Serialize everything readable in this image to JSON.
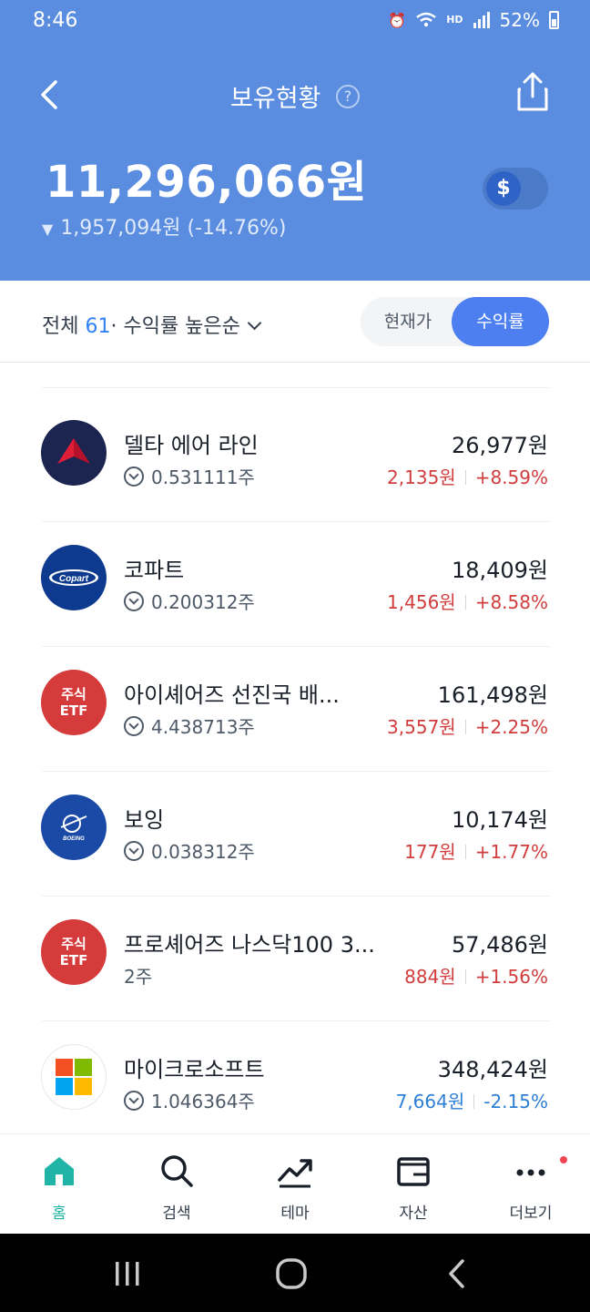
{
  "status_bar": {
    "time": "8:46",
    "hd_label": "HD",
    "battery": "52%"
  },
  "header": {
    "title": "보유현황",
    "help_symbol": "?",
    "total_value": "11,296,066원",
    "change_text": "1,957,094원 (-14.76%)",
    "change_direction": "down",
    "currency_toggle_symbol": "$",
    "background_color": "#5a8de0"
  },
  "filter": {
    "all_label": "전체",
    "count": "61",
    "sort_label": "· 수익률 높은순",
    "segment": {
      "current_price_label": "현재가",
      "return_label": "수익률",
      "selected": "수익률"
    }
  },
  "holdings": [
    {
      "name": "델타 에어 라인",
      "logo": "delta-logo",
      "quantity": "0.531111주",
      "value": "26,977원",
      "profit": "2,135원",
      "return": "+8.59%",
      "direction": "up"
    },
    {
      "name": "코파트",
      "logo": "copart-logo",
      "logo_text": "Copart",
      "quantity": "0.200312주",
      "value": "18,409원",
      "profit": "1,456원",
      "return": "+8.58%",
      "direction": "up"
    },
    {
      "name": "아이셰어즈 선진국 배...",
      "logo": "etf-badge",
      "logo_line1": "주식",
      "logo_line2": "ETF",
      "quantity": "4.438713주",
      "value": "161,498원",
      "profit": "3,557원",
      "return": "+2.25%",
      "direction": "up"
    },
    {
      "name": "보잉",
      "logo": "boeing-logo",
      "logo_text": "BOEING",
      "quantity": "0.038312주",
      "value": "10,174원",
      "profit": "177원",
      "return": "+1.77%",
      "direction": "up"
    },
    {
      "name": "프로셰어즈 나스닥100 3...",
      "logo": "etf-badge",
      "logo_line1": "주식",
      "logo_line2": "ETF",
      "quantity": "2주",
      "value": "57,486원",
      "profit": "884원",
      "return": "+1.56%",
      "direction": "up"
    },
    {
      "name": "마이크로소프트",
      "logo": "microsoft-logo",
      "quantity": "1.046364주",
      "value": "348,424원",
      "profit": "7,664원",
      "return": "-2.15%",
      "direction": "down"
    }
  ],
  "bottom_nav": [
    {
      "label": "홈",
      "icon": "home-icon",
      "active": true
    },
    {
      "label": "검색",
      "icon": "search-icon",
      "active": false
    },
    {
      "label": "테마",
      "icon": "trend-icon",
      "active": false
    },
    {
      "label": "자산",
      "icon": "wallet-icon",
      "active": false
    },
    {
      "label": "더보기",
      "icon": "more-icon",
      "active": false
    }
  ],
  "colors": {
    "up": "#d13d3d",
    "down": "#2d7fd6",
    "accent": "#4d7ff0",
    "active_tab": "#1fb4a6"
  }
}
